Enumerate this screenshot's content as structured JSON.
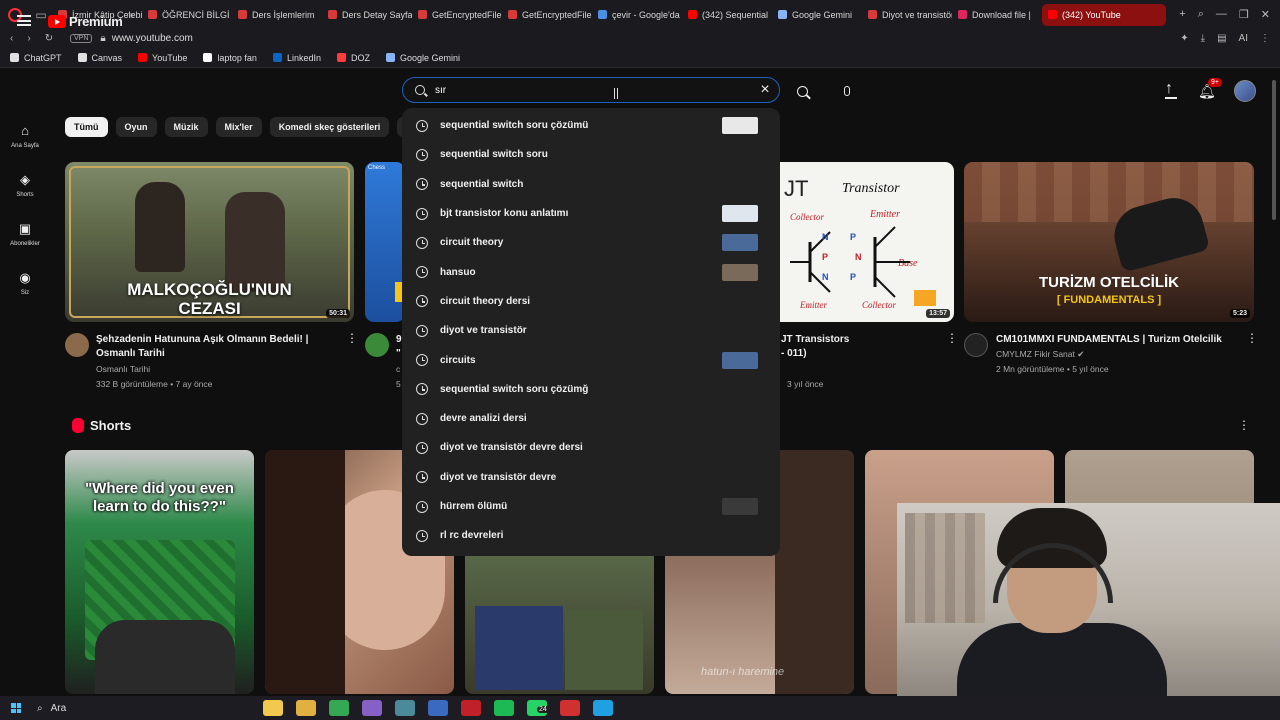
{
  "browser": {
    "tabs": [
      {
        "label": "İzmir Kâtip Çelebi",
        "color": "#d83a3a"
      },
      {
        "label": "ÖĞRENCİ BİLGİ",
        "color": "#d83a3a"
      },
      {
        "label": "Ders İşlemlerim",
        "color": "#d83a3a"
      },
      {
        "label": "Ders Detay Sayfa",
        "color": "#d83a3a"
      },
      {
        "label": "GetEncryptedFile",
        "color": "#d83a3a"
      },
      {
        "label": "GetEncryptedFile",
        "color": "#d83a3a"
      },
      {
        "label": "çevir - Google'da",
        "color": "#4a90e2"
      },
      {
        "label": "(342) Sequential",
        "color": "#ff0000"
      },
      {
        "label": "Google Gemini",
        "color": "#8ab4f8"
      },
      {
        "label": "Diyot ve transistör",
        "color": "#d83a3a"
      },
      {
        "label": "Download file | ",
        "color": "#e0245e"
      },
      {
        "label": "(342) YouTube",
        "color": "#ff0000"
      }
    ],
    "url": "www.youtube.com",
    "vpn_label": "VPN",
    "ai_label": "AI",
    "bookmarks": [
      {
        "label": "ChatGPT",
        "color": "#e0e0e0"
      },
      {
        "label": "Canvas",
        "color": "#e0e0e0"
      },
      {
        "label": "YouTube",
        "color": "#ff0000"
      },
      {
        "label": "laptop fan",
        "color": "#ffffff"
      },
      {
        "label": "LinkedIn",
        "color": "#0a66c2"
      },
      {
        "label": "DOZ",
        "color": "#ff3b3b"
      },
      {
        "label": "Google Gemini",
        "color": "#8ab4f8"
      }
    ]
  },
  "header": {
    "logo_word": "Premium",
    "logo_region": "TR",
    "search_value": "sır",
    "notification_count": "9+"
  },
  "guide": [
    {
      "label": "Ana Sayfa",
      "icon": "home-icon",
      "glyph": "⌂"
    },
    {
      "label": "Shorts",
      "icon": "shorts-icon",
      "glyph": "◈"
    },
    {
      "label": "Abonelikler",
      "icon": "subscriptions-icon",
      "glyph": "▣"
    },
    {
      "label": "Siz",
      "icon": "you-icon",
      "glyph": "◉"
    }
  ],
  "chips": [
    "Tümü",
    "Oyun",
    "Müzik",
    "Mix'ler",
    "Komedi skeç gösterileri",
    "Fut"
  ],
  "videos": [
    {
      "title_line1": "Şehzadenin Hatununa Aşık Olmanın Bedeli! |",
      "title_line2": "Osmanlı Tarihi",
      "channel": "Osmanlı Tarihi",
      "stats": "332 B görüntüleme • 7 ay önce",
      "duration": "50:31",
      "thumb_text1": "MALKOÇOĞLU'NUN",
      "thumb_text2": "CEZASI"
    },
    {
      "title_line1": "9",
      "title_line2": "\"",
      "channel": "c",
      "stats": "5",
      "duration": "",
      "thumb_text1": "Chess",
      "thumb_text2": ""
    },
    {
      "title_line1": "JT Transistors",
      "title_line2": "- 011)",
      "channel": "",
      "stats": "3 yıl önce",
      "duration": "13:57",
      "thumb_text1": "JT",
      "thumb_text2": "Transistor"
    },
    {
      "title_line1": "CM101MMXI FUNDAMENTALS | Turizm Otelcilik",
      "title_line2": "",
      "channel": "CMYLMZ Fikir Sanat",
      "stats": "2 Mn görüntüleme • 5 yıl önce",
      "duration": "5:23",
      "thumb_text1": "TURİZM OTELCİLİK",
      "thumb_text2": "[ FUNDAMENTALS ]"
    }
  ],
  "diagram_labels": {
    "collector": "Collector",
    "emitter": "Emitter",
    "base": "Base",
    "n": "N",
    "p": "P"
  },
  "shorts": {
    "title": "Shorts",
    "first_caption": "\"Where did you even learn to do this??\"",
    "watermark": "hatun-ı hareminе"
  },
  "suggestions": [
    {
      "text": "sequential switch soru çözümü",
      "thumb": "#e8e8e8"
    },
    {
      "text": "sequential switch soru",
      "thumb": ""
    },
    {
      "text": "sequential switch",
      "thumb": ""
    },
    {
      "text": "bjt transistor konu anlatımı",
      "thumb": "#dfe6ee"
    },
    {
      "text": "circuit theory",
      "thumb": "#4a6a9a"
    },
    {
      "text": "hansuo",
      "thumb": "#7a6a5a"
    },
    {
      "text": "circuit theory dersi",
      "thumb": ""
    },
    {
      "text": "diyot ve transistör",
      "thumb": ""
    },
    {
      "text": "circuits",
      "thumb": "#4a6a9a"
    },
    {
      "text": "sequential switch soru çözümğ",
      "thumb": ""
    },
    {
      "text": "devre analizi dersi",
      "thumb": ""
    },
    {
      "text": "diyot ve transistör devre dersi",
      "thumb": ""
    },
    {
      "text": "diyot ve transistör devre",
      "thumb": ""
    },
    {
      "text": "hürrem ölümü",
      "thumb": "#3a3a3a"
    },
    {
      "text": "rl rc devreleri",
      "thumb": ""
    }
  ],
  "taskbar": {
    "search_label": "Ara",
    "apps": [
      {
        "name": "file-explorer",
        "color": "#f2c94c"
      },
      {
        "name": "folder",
        "color": "#e0b040"
      },
      {
        "name": "chrome",
        "color": "#34a853"
      },
      {
        "name": "visual-studio",
        "color": "#8661c5"
      },
      {
        "name": "app-5",
        "color": "#4a8a9a"
      },
      {
        "name": "app-6",
        "color": "#3a6ac0"
      },
      {
        "name": "opera",
        "color": "#c0202a"
      },
      {
        "name": "spotify",
        "color": "#1db954"
      },
      {
        "name": "whatsapp",
        "color": "#25d366"
      },
      {
        "name": "app-10",
        "color": "#d03030"
      },
      {
        "name": "edge",
        "color": "#1fa0e0"
      }
    ],
    "whatsapp_badge": "24"
  }
}
